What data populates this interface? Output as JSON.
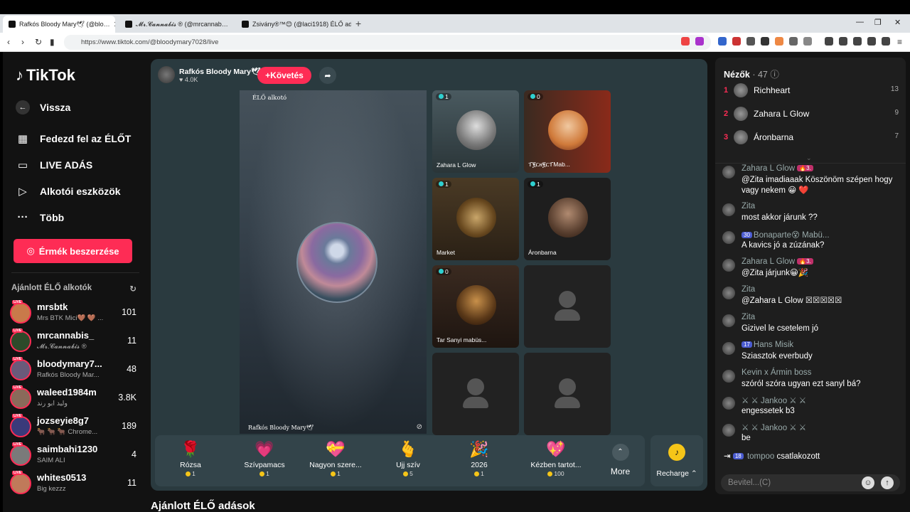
{
  "browser": {
    "tabs": [
      {
        "title": "Rafkós Bloody Mary🕊 (@blo…",
        "active": true
      },
      {
        "title": "𝓜𝓻.𝓒𝓪𝓷𝓷𝓪𝓫𝓲𝓼 ® (@mrcannab…",
        "active": false
      },
      {
        "title": "Zsivány®™😊 (@laci1918) ÉLŐ adás…",
        "active": false
      }
    ],
    "url": "https://www.tiktok.com/@bloodymary7028/live"
  },
  "sidebar": {
    "logo": "TikTok",
    "back": "Vissza",
    "menu": [
      {
        "label": "Fedezd fel az ÉLŐT",
        "icon": "live-tv-icon"
      },
      {
        "label": "LIVE ADÁS",
        "icon": "camera-icon"
      },
      {
        "label": "Alkotói eszközök",
        "icon": "creator-tools-icon"
      },
      {
        "label": "Több",
        "icon": "more-dots-icon"
      }
    ],
    "coins_button": "Érmék beszerzése",
    "recommended_title": "Ajánlott ÉLŐ alkotók",
    "creators": [
      {
        "name": "mrsbtk",
        "sub": "Mrs BTK Mici🤎 🤎 ...",
        "count": "101",
        "color": "#c97a4a"
      },
      {
        "name": "mrcannabis_",
        "sub": "𝓜𝓻.𝓒𝓪𝓷𝓷𝓪𝓫𝓲𝓼 ®",
        "count": "11",
        "color": "#2d4a2a"
      },
      {
        "name": "bloodymary7...",
        "sub": "Rafkós Bloody Mar...",
        "count": "48",
        "color": "#6a5a7a"
      },
      {
        "name": "waleed1984m",
        "sub": "وليد ابو رند",
        "count": "3.8K",
        "color": "#8a6a5a"
      },
      {
        "name": "jozseyie8g7",
        "sub": "🐂 🐂 🐂 Chrome...",
        "count": "189",
        "color": "#3a3a7a"
      },
      {
        "name": "saimbahi1230",
        "sub": "SAIM ALI",
        "count": "4",
        "color": "#7a7a7a"
      },
      {
        "name": "whites0513",
        "sub": "Big kezzz",
        "count": "11",
        "color": "#c07a5a"
      }
    ]
  },
  "stage": {
    "host_name": "Rafkós Bloody Mary🕊",
    "host_likes": "4.0K",
    "follow_label": "Követés",
    "main_tag": "ÉLŐ alkotó",
    "main_footer": "Rafkós Bloody Mary🕊",
    "guests": [
      {
        "name": "Zahara L Glow",
        "viewers": "1"
      },
      {
        "name": "ፐ፪ርዘ፪ርፐMab...",
        "viewers": "0"
      },
      {
        "name": "Market",
        "viewers": "1"
      },
      {
        "name": "Áronbarna",
        "viewers": "1"
      },
      {
        "name": "Tar Sanyi mabüs...",
        "viewers": "0"
      }
    ],
    "gifts": [
      {
        "name": "Rózsa",
        "price": "1",
        "icon": "🌹"
      },
      {
        "name": "Szívpamacs",
        "price": "1",
        "icon": "💗"
      },
      {
        "name": "Nagyon szere...",
        "price": "1",
        "icon": "💝"
      },
      {
        "name": "Ujj szív",
        "price": "5",
        "icon": "🫰"
      },
      {
        "name": "2026",
        "price": "1",
        "icon": "🎉"
      },
      {
        "name": "Kézben tartot...",
        "price": "100",
        "icon": "💖"
      }
    ],
    "more_label": "More",
    "recharge_label": "Recharge"
  },
  "bottom_title": "Ajánlott ÉLŐ adások",
  "chat": {
    "viewers_title": "Nézők",
    "viewers_count": "47",
    "top_viewers": [
      {
        "rank": "1",
        "name": "Richheart",
        "score": "13"
      },
      {
        "rank": "2",
        "name": "Zahara L Glow",
        "score": "9"
      },
      {
        "rank": "3",
        "name": "Áronbarna",
        "score": "7"
      }
    ],
    "messages": [
      {
        "user": "Zahara L Glow",
        "badge": "🔥3.",
        "text": "@Zita imadiaaak Köszönöm szépen hogy vagy nekem 😀 ❤️"
      },
      {
        "user": "Zita",
        "badge": "",
        "text": "most akkor járunk ??"
      },
      {
        "user": "Bonaparte😵 Mabü...",
        "badge": "30",
        "text": "A kavics jó a zúzának?"
      },
      {
        "user": "Zahara L Glow",
        "badge": "🔥3.",
        "text": "@Zita járjunk😀🎉"
      },
      {
        "user": "Zita",
        "badge": "",
        "text": "@Zahara L Glow ☒☒☒☒☒"
      },
      {
        "user": "Zita",
        "badge": "",
        "text": "Gizivel le csetelem jó"
      },
      {
        "user": "Hans Misik",
        "badge": "17",
        "text": "Sziasztok everbudy"
      },
      {
        "user": "Kevin x Ármin boss",
        "badge": "",
        "text": "szóról szóra ugyan ezt sanyl bá?"
      },
      {
        "user": "⚔ ⚔ Jankoo ⚔ ⚔",
        "badge": "",
        "text": "engessetek b3"
      },
      {
        "user": "⚔ ⚔ Jankoo ⚔ ⚔",
        "badge": "",
        "text": "be"
      }
    ],
    "join": {
      "badge": "18",
      "user": "tompoo",
      "text": "csatlakozott"
    },
    "input_placeholder": "Bevitel...(C)"
  },
  "colors": {
    "accent": "#fe2c55",
    "stage_bg": "#2a3a3f",
    "coin": "#f5c518"
  }
}
